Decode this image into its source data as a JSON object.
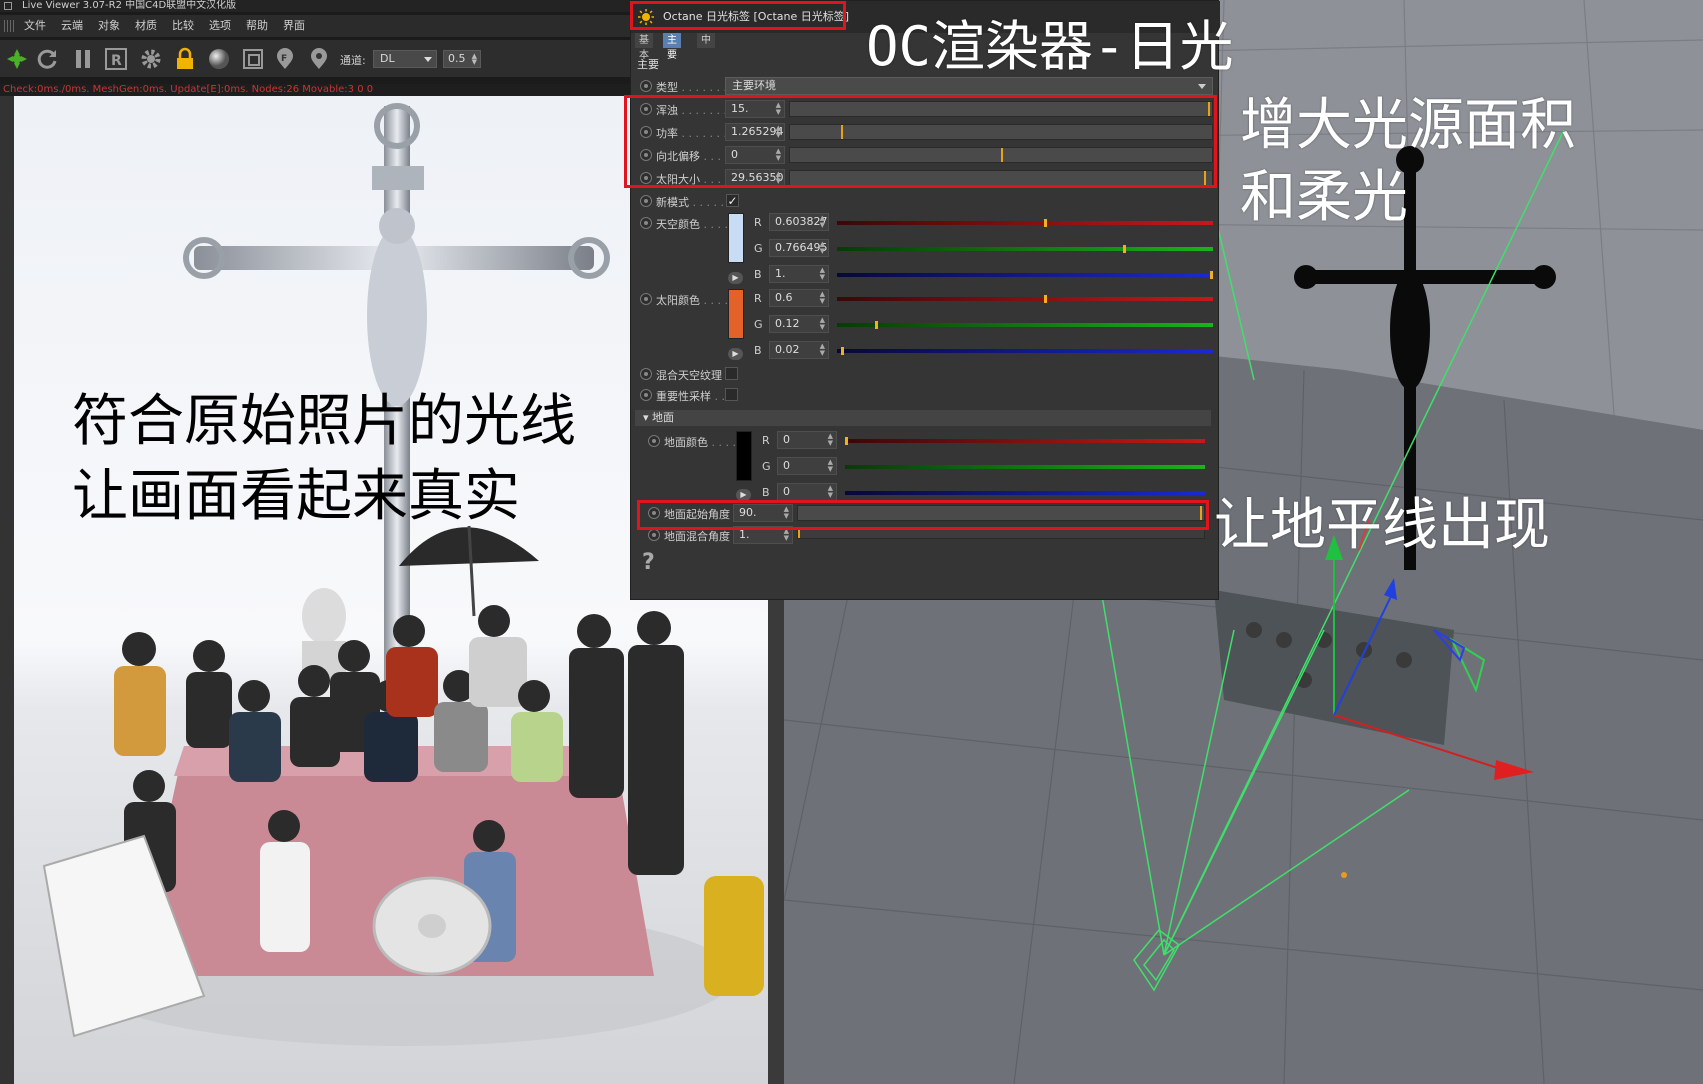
{
  "live_viewer": {
    "title": "Live Viewer 3.07-R2 中国C4D联盟中文汉化版",
    "menu": [
      "文件",
      "云端",
      "对象",
      "材质",
      "比较",
      "选项",
      "帮助",
      "界面"
    ],
    "channel_label": "通道:",
    "channel_value": "DL",
    "channel_num": "0.5",
    "status_text": "Check:0ms./0ms. MeshGen:0ms. Update[E]:0ms. Nodes:26 Movable:3 0 0"
  },
  "octane_panel": {
    "title": "Octane 日光标签 [Octane 日光标签]",
    "tabs": [
      "基本",
      "主要",
      "中"
    ],
    "active_tab": "主要",
    "section": "主要",
    "type_label": "类型",
    "type_value": "主要环境",
    "turbidity": {
      "label": "浑浊",
      "value": "15.",
      "fraction": 0.99
    },
    "power": {
      "label": "功率",
      "value": "1.265294",
      "fraction": 0.12
    },
    "north_offset": {
      "label": "向北偏移",
      "value": "0",
      "fraction": 0.5
    },
    "sun_size": {
      "label": "太阳大小",
      "value": "29.56350",
      "fraction": 0.98
    },
    "new_mode_label": "新模式",
    "new_mode_checked": "✓",
    "sky_color": {
      "label": "天空颜色",
      "swatch": "#c8dcf4",
      "r": "0.603827",
      "g": "0.766495",
      "b": "1.",
      "r_frac": 0.55,
      "g_frac": 0.76,
      "b_frac": 1.0
    },
    "sun_color": {
      "label": "太阳颜色",
      "swatch": "#e2622a",
      "r": "0.6",
      "g": "0.12",
      "b": "0.02",
      "r_frac": 0.55,
      "g_frac": 0.1,
      "b_frac": 0.01
    },
    "mix_sky_texture_label": "混合天空纹理",
    "importance_sampling_label": "重要性采样",
    "ground_group": "地面",
    "ground_color": {
      "label": "地面颜色",
      "swatch": "#000000",
      "r": "0",
      "g": "0",
      "b": "0"
    },
    "ground_start_angle": {
      "label": "地面起始角度",
      "value": "90.",
      "fraction": 0.99
    },
    "ground_blend_angle": {
      "label": "地面混合角度",
      "value": "1.",
      "fraction": 0.0
    },
    "help": "?",
    "channel_letters": {
      "r": "R",
      "g": "G",
      "b": "B"
    }
  },
  "annotations": {
    "title": "OC渲染器-日光",
    "sun_size_note_line1": "增大光源面积",
    "sun_size_note_line2": "和柔光",
    "photo_note_line1": "符合原始照片的光线",
    "photo_note_line2": "让画面看起来真实",
    "horizon_note": "让地平线出现"
  },
  "colors": {
    "highlight": "#e0141c",
    "slider_mark": "#e8a21a",
    "red_channel": "#c81818",
    "green_channel": "#18b418",
    "blue_channel": "#1a2ad0"
  }
}
